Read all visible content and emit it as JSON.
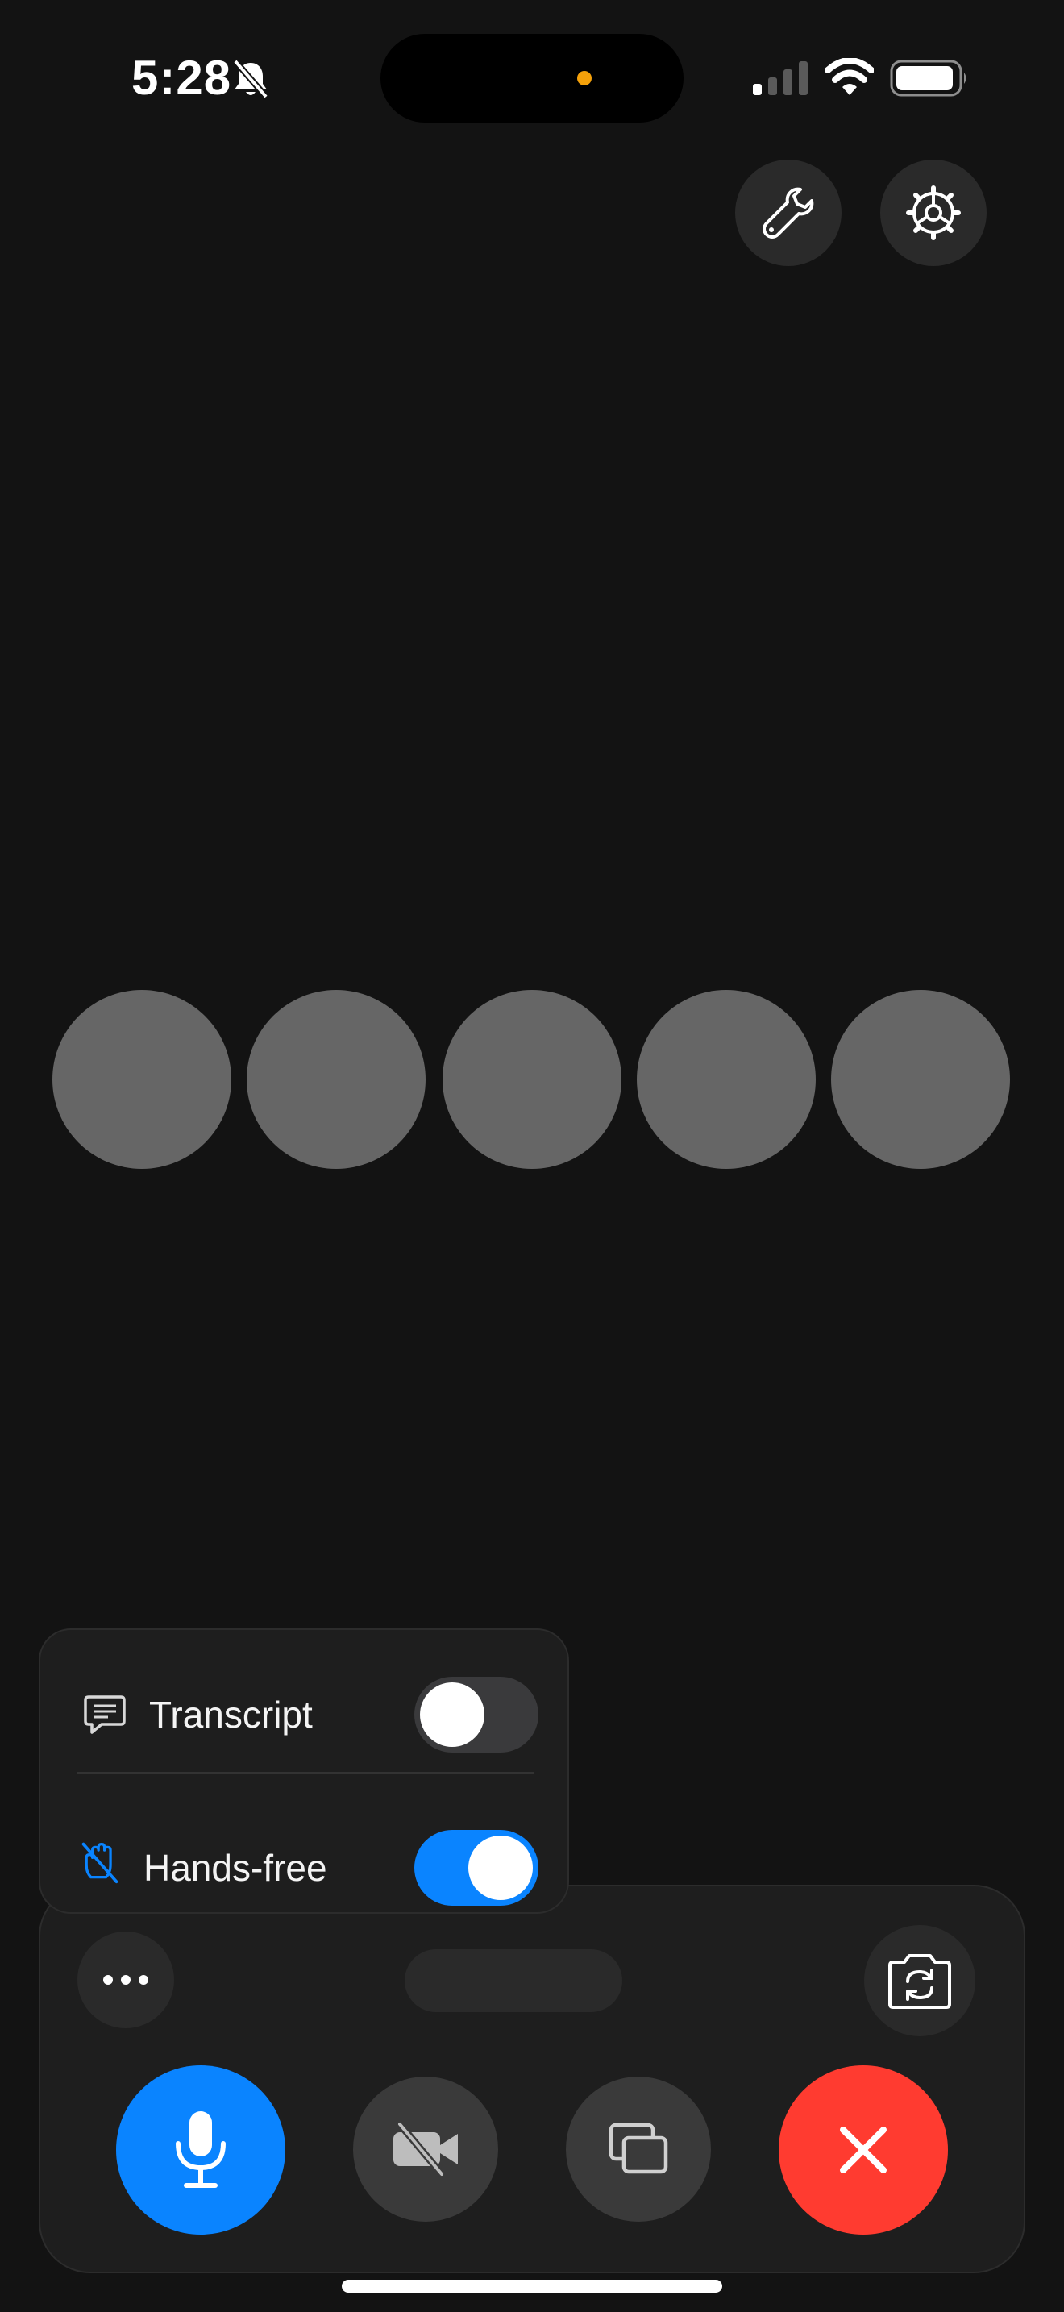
{
  "status_bar": {
    "time": "5:28",
    "icons": [
      "bell-slash-icon",
      "cellular-signal-icon",
      "wifi-icon",
      "battery-icon"
    ],
    "recording_dot_color": "#f5a10a"
  },
  "top_buttons": {
    "icons": [
      "wrench-icon",
      "gear-icon"
    ]
  },
  "loading_dots": {
    "count": 5,
    "color": "#666666"
  },
  "options_menu": {
    "items": [
      {
        "label": "Transcript",
        "icon": "transcript-bubble-icon",
        "enabled": false
      },
      {
        "label": "Hands-free",
        "icon": "hand-slash-icon",
        "enabled": true
      }
    ]
  },
  "control_panel": {
    "more_icon": "ellipsis-icon",
    "flip_icon": "camera-flip-icon",
    "controls": [
      {
        "name": "mic",
        "icon": "microphone-icon",
        "color": "#0a84ff"
      },
      {
        "name": "video",
        "icon": "video-off-icon",
        "color": "#3a3a3a"
      },
      {
        "name": "share",
        "icon": "screen-share-icon",
        "color": "#3a3a3a"
      },
      {
        "name": "end",
        "icon": "close-icon",
        "color": "#ff3b30"
      }
    ]
  },
  "colors": {
    "background": "#131313",
    "accent": "#0a84ff",
    "danger": "#ff3b30"
  }
}
